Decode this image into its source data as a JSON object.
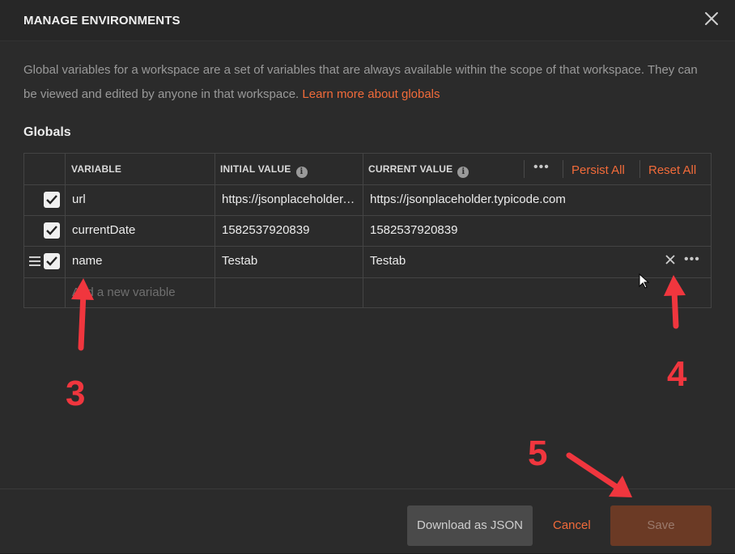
{
  "modal": {
    "title": "MANAGE ENVIRONMENTS",
    "description": "Global variables for a workspace are a set of variables that are always available within the scope of that workspace. They can be viewed and edited by anyone in that workspace.",
    "learn_more_link": "Learn more about globals",
    "section_heading": "Globals"
  },
  "table": {
    "headers": {
      "variable": "VARIABLE",
      "initial_value": "INITIAL VALUE",
      "current_value": "CURRENT VALUE",
      "persist_all": "Persist All",
      "reset_all": "Reset All"
    },
    "rows": [
      {
        "checked": true,
        "variable": "url",
        "initial_value": "https://jsonplaceholder.typicode.com",
        "current_value": "https://jsonplaceholder.typicode.com"
      },
      {
        "checked": true,
        "variable": "currentDate",
        "initial_value": "1582537920839",
        "current_value": "1582537920839"
      },
      {
        "checked": true,
        "variable": "name",
        "initial_value": "Testab",
        "current_value": "Testab"
      }
    ],
    "new_variable_placeholder": "Add a new variable"
  },
  "footer": {
    "download_json": "Download as JSON",
    "cancel": "Cancel",
    "save": "Save"
  },
  "annotations": {
    "step_3": "3",
    "step_4": "4",
    "step_5": "5"
  },
  "colors": {
    "accent": "#f26b3a",
    "annotation_red": "#f0363e",
    "background": "#2b2b2b"
  },
  "icons": [
    "close-icon",
    "info-icon",
    "more-icon",
    "drag-handle-icon",
    "delete-icon",
    "checkbox-check-icon",
    "mouse-cursor-icon"
  ]
}
